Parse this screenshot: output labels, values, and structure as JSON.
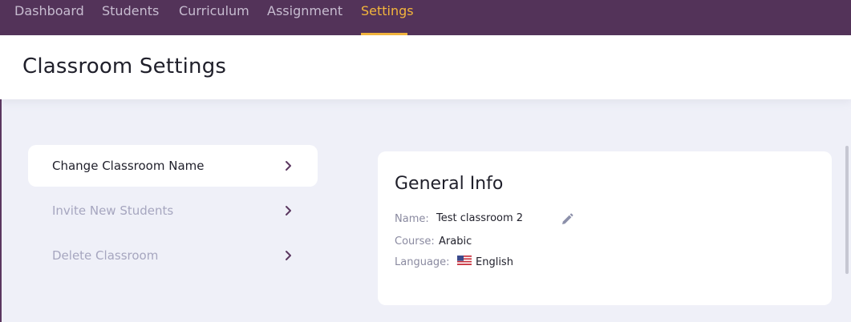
{
  "nav": {
    "items": [
      {
        "label": "Dashboard"
      },
      {
        "label": "Students"
      },
      {
        "label": "Curriculum"
      },
      {
        "label": "Assignment"
      },
      {
        "label": "Settings"
      }
    ],
    "active": "Settings"
  },
  "page": {
    "title": "Classroom Settings"
  },
  "menu": {
    "items": [
      {
        "label": "Change Classroom Name",
        "icon": "chevron-right-icon"
      },
      {
        "label": "Invite New Students",
        "icon": "chevron-right-icon"
      },
      {
        "label": "Delete Classroom",
        "icon": "chevron-right-icon"
      }
    ],
    "active": "Change Classroom Name"
  },
  "card": {
    "title": "General Info",
    "name_label": "Name:",
    "name_value": "Test classroom 2",
    "course_label": "Course:",
    "course_value": "Arabic",
    "language_label": "Language:",
    "language_value": "English",
    "edit_icon": "pencil-icon",
    "flag_icon": "us-flag-icon"
  },
  "colors": {
    "nav_bg": "#533359",
    "accent": "#f3b53c",
    "page_bg": "#eff0f8",
    "chevron": "#5b3760"
  }
}
